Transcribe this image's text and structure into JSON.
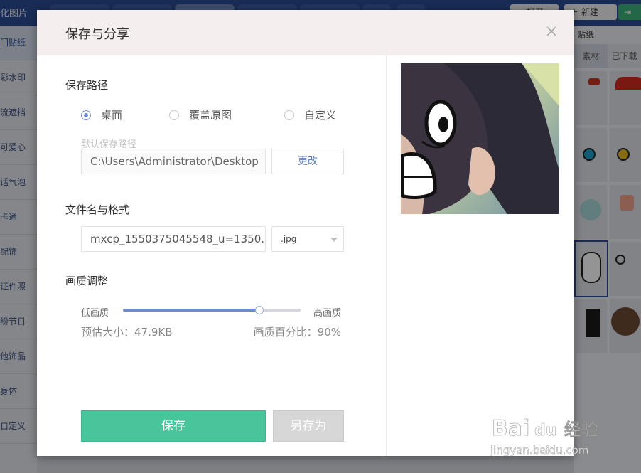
{
  "background": {
    "app_title": "化图片",
    "tabs": [
      "",
      "",
      "",
      "",
      "",
      "",
      "",
      "",
      ""
    ],
    "open_label": "打开",
    "new_label": "新建",
    "sidebar_items": [
      "门贴纸",
      "彩水印",
      "流遮挡",
      "可爱心",
      "话气泡",
      "卡通",
      "配饰",
      "证件照",
      "纷节日",
      "他饰品",
      "身体",
      "自定义"
    ],
    "right_title": "贴纸",
    "right_tabs": [
      "素材",
      "已下载"
    ]
  },
  "modal": {
    "title": "保存与分享",
    "path_section_title": "保存路径",
    "radio_options": [
      {
        "label": "桌面",
        "checked": true
      },
      {
        "label": "覆盖原图",
        "checked": false
      },
      {
        "label": "自定义",
        "checked": false
      }
    ],
    "default_path_hint": "默认保存路径",
    "path_value": "C:\\Users\\Administrator\\Desktop",
    "change_label": "更改",
    "file_section_title": "文件名与格式",
    "filename_value": "mxcp_1550375045548_u=1350...",
    "format_value": ".jpg",
    "quality_section_title": "画质调整",
    "quality_low_label": "低画质",
    "quality_high_label": "高画质",
    "quality_value": 0.9,
    "estimated_size": "预估大小：47.9KB",
    "quality_percent": "画质百分比：90%",
    "save_label": "保存",
    "save_as_label": "另存为"
  },
  "watermark": {
    "brand": "Bai",
    "brand_suffix": "du",
    "product": "经验",
    "url": "jingyan.baidu.com"
  },
  "colors": {
    "accent_blue": "#6e8acb",
    "save_green": "#48c59b",
    "header_bg": "#f4efee",
    "disabled_gray": "#d7d7d7"
  }
}
